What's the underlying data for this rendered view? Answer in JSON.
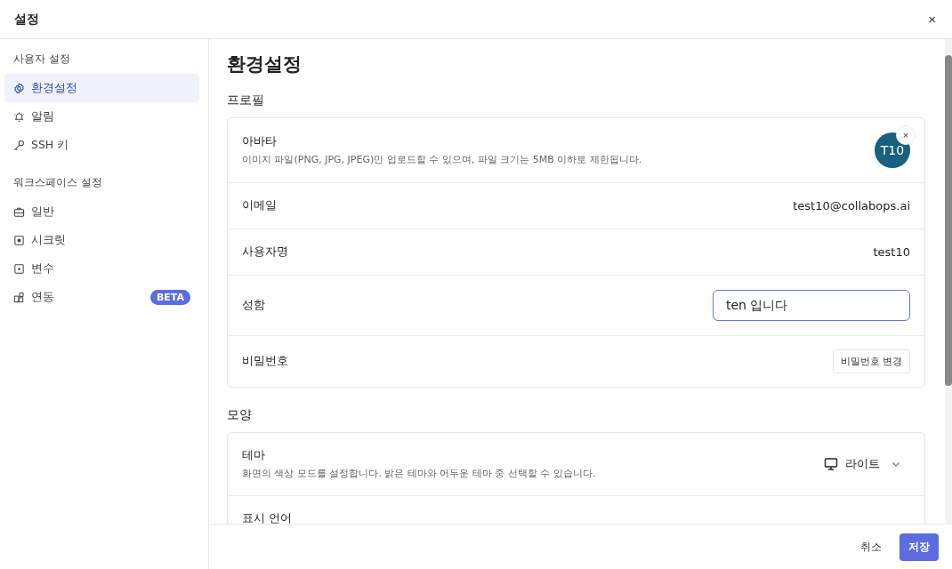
{
  "window": {
    "title": "설정",
    "close": "×"
  },
  "sidebar": {
    "groups": [
      {
        "heading": "사용자 설정",
        "items": [
          {
            "label": "환경설정",
            "kind": "gear",
            "selected": true
          },
          {
            "label": "알림",
            "kind": "bell",
            "selected": false
          },
          {
            "label": "SSH 키",
            "kind": "key",
            "selected": false
          }
        ]
      },
      {
        "heading": "워크스페이스 설정",
        "items": [
          {
            "label": "일반",
            "kind": "briefcase",
            "selected": false
          },
          {
            "label": "시크릿",
            "kind": "secret",
            "selected": false
          },
          {
            "label": "변수",
            "kind": "variable",
            "selected": false
          },
          {
            "label": "연동",
            "kind": "blocks",
            "selected": false,
            "badge": "BETA"
          }
        ]
      }
    ]
  },
  "page": {
    "title": "환경설정",
    "sections": [
      {
        "heading": "프로필",
        "rows": [
          {
            "kind": "avatar",
            "label": "아바타",
            "description": "이미지 파일(PNG, JPG, JPEG)만 업로드할 수 있으며, 파일 크기는 5MB 이하로 제한됩니다.",
            "value": "T10",
            "remove": "×"
          },
          {
            "kind": "text",
            "label": "이메일",
            "value": "test10@collabops.ai"
          },
          {
            "kind": "text",
            "label": "사용자명",
            "value": "test10"
          },
          {
            "kind": "input",
            "label": "성함",
            "value": "ten 입니다"
          },
          {
            "kind": "button",
            "label": "비밀번호",
            "value": "비밀번호 변경"
          }
        ]
      },
      {
        "heading": "모양",
        "rows": [
          {
            "kind": "select",
            "label": "테마",
            "description": "화면의 색상 모드를 설정합니다. 밝은 테마와 어두운 테마 중 선택할 수 있습니다.",
            "value": "라이트"
          },
          {
            "kind": "text",
            "label": "표시 언어"
          }
        ]
      }
    ]
  },
  "footer": {
    "buttons": [
      {
        "label": "취소",
        "kind": "plain"
      },
      {
        "label": "저장",
        "kind": "primary"
      }
    ]
  }
}
